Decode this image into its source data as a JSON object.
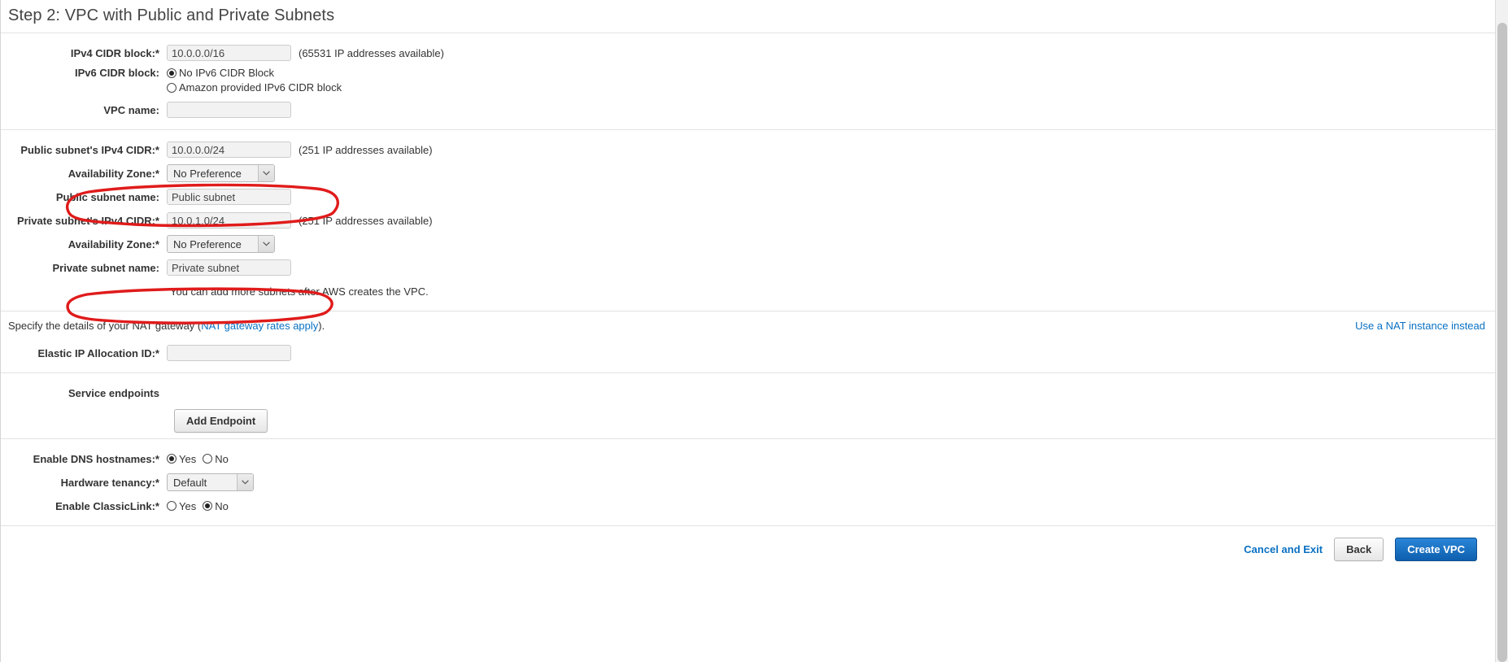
{
  "wizard": {
    "title": "Step 2: VPC with Public and Private Subnets"
  },
  "vpc_section": {
    "ipv4_cidr": {
      "label": "IPv4 CIDR block:*",
      "value": "10.0.0.0/16",
      "hint": "(65531 IP addresses available)"
    },
    "ipv6_cidr": {
      "label": "IPv6 CIDR block:",
      "options": [
        {
          "label": "No IPv6 CIDR Block",
          "selected": true
        },
        {
          "label": "Amazon provided IPv6 CIDR block",
          "selected": false
        }
      ]
    },
    "vpc_name": {
      "label": "VPC name:",
      "value": "",
      "placeholder": ""
    }
  },
  "subnet_section": {
    "public_cidr": {
      "label": "Public subnet's IPv4 CIDR:*",
      "value": "10.0.0.0/24",
      "hint": "(251 IP addresses available)"
    },
    "public_az": {
      "label": "Availability Zone:*",
      "value": "No Preference"
    },
    "public_name": {
      "label": "Public subnet name:",
      "value": "Public subnet"
    },
    "private_cidr": {
      "label": "Private subnet's IPv4 CIDR:*",
      "value": "10.0.1.0/24",
      "hint": "(251 IP addresses available)"
    },
    "private_az": {
      "label": "Availability Zone:*",
      "value": "No Preference"
    },
    "private_name": {
      "label": "Private subnet name:",
      "value": "Private subnet"
    },
    "note": "You can add more subnets after AWS creates the VPC."
  },
  "nat_section": {
    "text_before": "Specify the details of your NAT gateway (",
    "rates_link": "NAT gateway rates apply",
    "text_after": ").",
    "nat_instance_link": "Use a NAT instance instead",
    "eip_allocation": {
      "label": "Elastic IP Allocation ID:*",
      "value": "",
      "placeholder": ""
    }
  },
  "endpoints_section": {
    "label": "Service endpoints",
    "add_button": "Add Endpoint"
  },
  "options_section": {
    "dns_hostnames": {
      "label": "Enable DNS hostnames:*",
      "options": [
        {
          "label": "Yes",
          "selected": true
        },
        {
          "label": "No",
          "selected": false
        }
      ]
    },
    "hardware_tenancy": {
      "label": "Hardware tenancy:*",
      "value": "Default"
    },
    "classiclink": {
      "label": "Enable ClassicLink:*",
      "options": [
        {
          "label": "Yes",
          "selected": false
        },
        {
          "label": "No",
          "selected": true
        }
      ]
    }
  },
  "footer": {
    "cancel_label": "Cancel and Exit",
    "back_label": "Back",
    "create_label": "Create VPC"
  },
  "annotations": {
    "color": "#e01b1b",
    "items": [
      {
        "name": "public-az-highlight"
      },
      {
        "name": "private-az-highlight"
      }
    ]
  }
}
